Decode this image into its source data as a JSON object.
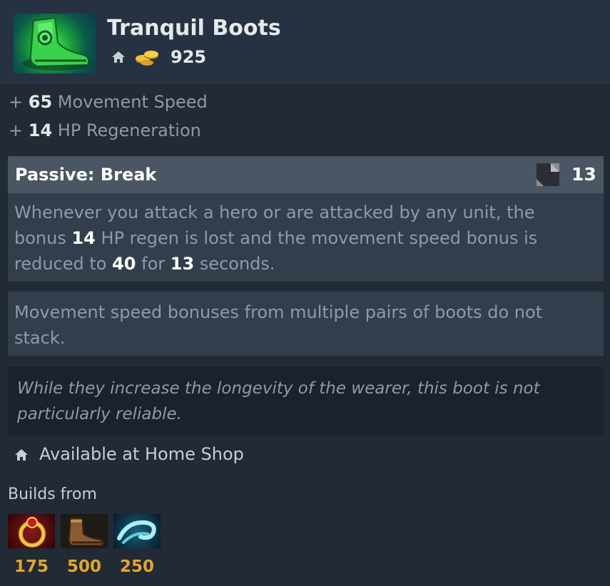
{
  "item": {
    "name": "Tranquil Boots",
    "icon": "tranquil-boots-icon",
    "cost": "925"
  },
  "stats": [
    {
      "prefix": "+",
      "value": "65",
      "label": "Movement Speed"
    },
    {
      "prefix": "+",
      "value": "14",
      "label": "HP Regeneration"
    }
  ],
  "ability": {
    "title": "Passive: Break",
    "cooldown": "13",
    "desc": {
      "p1": "Whenever you attack a hero or are attacked by any unit, the bonus ",
      "v1": "14",
      "p2": " HP regen is lost and the movement speed bonus is reduced to ",
      "v2": "40",
      "p3": " for ",
      "v3": "13",
      "p4": " seconds."
    }
  },
  "note": "Movement speed bonuses from multiple pairs of boots do not stack.",
  "lore": "While they increase the longevity of the wearer, this boot is not particularly reliable.",
  "availability": "Available at Home Shop",
  "builds_from": {
    "label": "Builds from",
    "components": [
      {
        "icon": "ring-of-regen-icon",
        "price": "175"
      },
      {
        "icon": "boots-of-speed-icon",
        "price": "500"
      },
      {
        "icon": "wind-lace-icon",
        "price": "250"
      }
    ]
  },
  "colors": {
    "background": "#212a35",
    "header": "#263241",
    "panel": "#323e4b",
    "ability_header": "#4a5663",
    "lore_panel": "#1a222c",
    "gold_text": "#e2a72e",
    "muted_text": "#8e9aa6",
    "bright_text": "#ffffff"
  }
}
